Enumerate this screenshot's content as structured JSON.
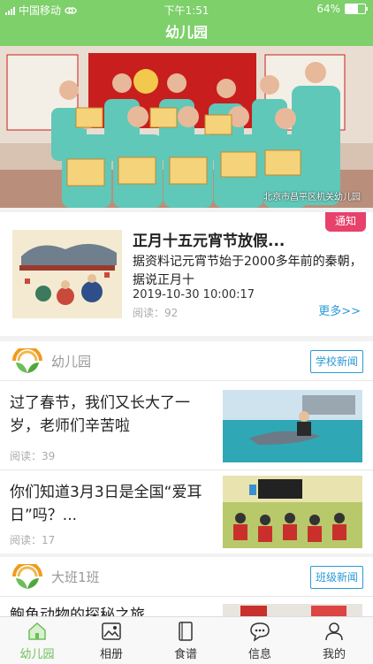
{
  "status_bar": {
    "carrier": "中国移动",
    "time": "下午1:51",
    "battery": "64%",
    "battery_level": 0.64
  },
  "nav": {
    "title": "幼儿园"
  },
  "banner": {
    "watermark": "北京市昌平区机关幼儿园"
  },
  "notice": {
    "tag": "通知",
    "title": "正月十五元宵节放假...",
    "summary": "据资料记元宵节始于2000多年前的秦朝，据说正月十",
    "datetime": "2019-10-30 10:00:17",
    "reads": "阅读：92",
    "more": "更多>>"
  },
  "school_section": {
    "name": "幼儿园",
    "button": "学校新闻",
    "articles": [
      {
        "title": "过了春节，我们又长大了一岁，老师们辛苦啦",
        "reads": "阅读：39"
      },
      {
        "title": "你们知道3月3日是全国“爱耳日”吗？...",
        "reads": "阅读：17"
      }
    ]
  },
  "class_section": {
    "name": "大班1班",
    "button": "班级新闻",
    "articles": [
      {
        "title": "鲍鱼动物的探秘之旅"
      }
    ]
  },
  "tabbar": {
    "items": [
      {
        "label": "幼儿园",
        "icon": "home-icon"
      },
      {
        "label": "相册",
        "icon": "album-icon"
      },
      {
        "label": "食谱",
        "icon": "recipe-icon"
      },
      {
        "label": "信息",
        "icon": "message-icon"
      },
      {
        "label": "我的",
        "icon": "profile-icon"
      }
    ],
    "active": 0
  },
  "colors": {
    "primary": "#7dd06a",
    "accent_blue": "#2a9ad6",
    "tag_red": "#e8416b"
  }
}
